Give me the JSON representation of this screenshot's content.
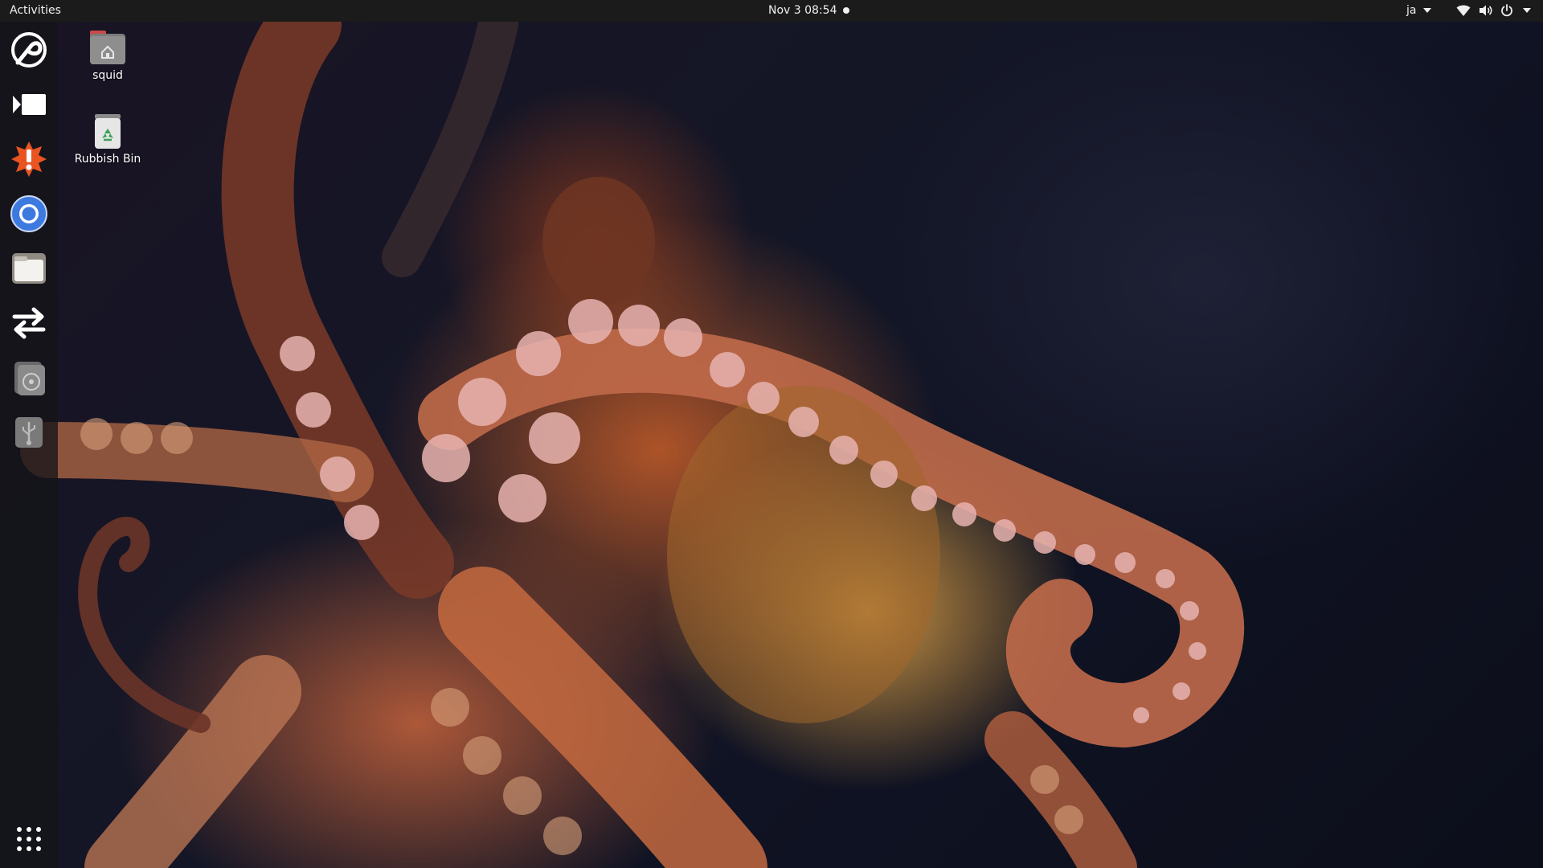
{
  "topbar": {
    "activities_label": "Activities",
    "clock": "Nov 3  08:54",
    "input_language": "ja",
    "tray_icons": [
      "wifi-icon",
      "volume-icon",
      "power-icon"
    ]
  },
  "dock": {
    "items": [
      {
        "icon": "app-launcher-swirl-icon"
      },
      {
        "icon": "video-player-icon"
      },
      {
        "icon": "software-updater-alert-icon"
      },
      {
        "icon": "chromium-browser-icon"
      },
      {
        "icon": "files-icon"
      },
      {
        "icon": "transfer-arrows-icon"
      },
      {
        "icon": "optical-drive-icon"
      },
      {
        "icon": "usb-drive-icon"
      }
    ],
    "show_apps_icon": "grid-icon"
  },
  "desktop": {
    "icons": [
      {
        "label": "squid",
        "icon": "home-folder-icon"
      },
      {
        "label": "Rubbish Bin",
        "icon": "trash-icon"
      }
    ]
  },
  "colors": {
    "topbar_bg": "#1b1b1b",
    "dock_bg": "#141418",
    "accent_orange": "#e95420",
    "chromium_blue": "#3d7ae0"
  }
}
